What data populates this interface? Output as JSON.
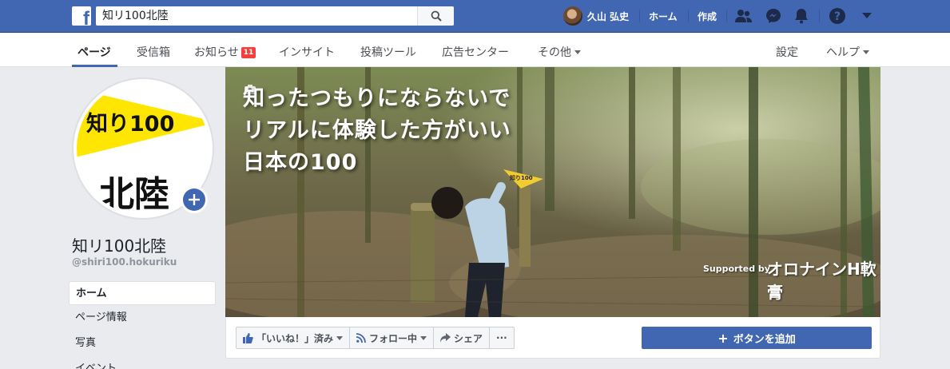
{
  "topbar": {
    "search_value": "知リ100北陸",
    "user_name": "久山 弘史",
    "home": "ホーム",
    "create": "作成"
  },
  "pagenav": {
    "tabs": [
      "ページ",
      "受信箱",
      "お知らせ",
      "インサイト",
      "投稿ツール",
      "広告センター",
      "その他"
    ],
    "notifications_badge": "11",
    "settings": "設定",
    "help": "ヘルプ"
  },
  "page": {
    "name": "知リ100北陸",
    "handle": "@shiri100.hokuriku",
    "logo_text_top": "知り100",
    "logo_text_bottom": "北陸"
  },
  "sidebar": {
    "items": [
      "ホーム",
      "ページ情報",
      "写真",
      "イベント"
    ]
  },
  "cover": {
    "lines": [
      "知ったつもりにならないで",
      "リアルに体験した方がいい",
      "日本の100"
    ],
    "flag": "知り100",
    "supported_by": "Supported by",
    "brand": "オロナインH軟膏"
  },
  "actions": {
    "liked": "「いいね！」済み",
    "following": "フォロー中",
    "share": "シェア",
    "more": "···",
    "add_button": "ボタンを追加"
  },
  "colors": {
    "brand_blue": "#4267b2",
    "badge_red": "#fa3e3e",
    "logo_yellow": "#ffe600"
  }
}
